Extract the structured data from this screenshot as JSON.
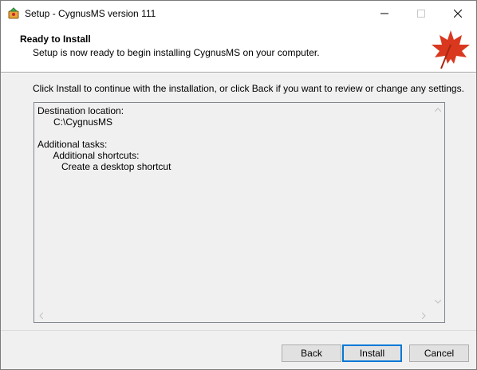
{
  "window": {
    "title": "Setup - CygnusMS version 111"
  },
  "header": {
    "title": "Ready to Install",
    "subtitle": "Setup is now ready to begin installing CygnusMS on your computer."
  },
  "instruction": "Click Install to continue with the installation, or click Back if you want to review or change any settings.",
  "memo": {
    "lines": [
      "Destination location:",
      "      C:\\CygnusMS",
      "",
      "Additional tasks:",
      "      Additional shortcuts:",
      "         Create a desktop shortcut"
    ]
  },
  "buttons": {
    "back": "Back",
    "install": "Install",
    "cancel": "Cancel"
  },
  "icons": {
    "app": "app-icon",
    "header": "maple-leaf-icon",
    "minimize": "minimize-icon",
    "maximize": "maximize-icon",
    "close": "close-icon"
  },
  "colors": {
    "accent": "#0078d7",
    "leaf": "#d9381e"
  }
}
